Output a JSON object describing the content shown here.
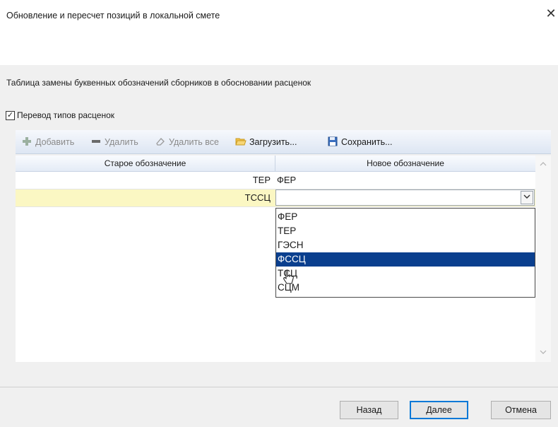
{
  "window": {
    "title": "Обновление и пересчет позиций в локальной смете",
    "close_glyph": "✕"
  },
  "content": {
    "description": "Таблица замены буквенных обозначений сборников в обосновании расценок",
    "checkbox": {
      "label": "Перевод типов расценок",
      "checked": true,
      "glyph": "✓"
    }
  },
  "toolbar": {
    "add": {
      "label": "Добавить",
      "icon": "plus-icon",
      "enabled": false
    },
    "delete": {
      "label": "Удалить",
      "icon": "minus-icon",
      "enabled": false
    },
    "delete_all": {
      "label": "Удалить все",
      "icon": "eraser-icon",
      "enabled": false
    },
    "load": {
      "label": "Загрузить...",
      "icon": "folder-open-icon",
      "enabled": true
    },
    "save": {
      "label": "Сохранить...",
      "icon": "floppy-disk-icon",
      "enabled": true
    }
  },
  "grid": {
    "columns": [
      "Старое обозначение",
      "Новое обозначение"
    ],
    "rows": [
      {
        "old": "ТЕР",
        "new": "ФЕР"
      },
      {
        "old": "ТССЦ",
        "new": ""
      }
    ],
    "active_row": 1
  },
  "dropdown": {
    "options": [
      "ФЕР",
      "ТЕР",
      "ГЭСН",
      "ФССЦ",
      "ТСЦ",
      "СЦМ"
    ],
    "highlighted": "ФССЦ"
  },
  "footer": {
    "back_label": "Назад",
    "next_label": "Далее",
    "cancel_label": "Отмена"
  },
  "colors": {
    "active_row": "#fbf7c3",
    "selection": "#0a3f8e",
    "toolbar_gradient_bottom": "#dde6f3"
  }
}
